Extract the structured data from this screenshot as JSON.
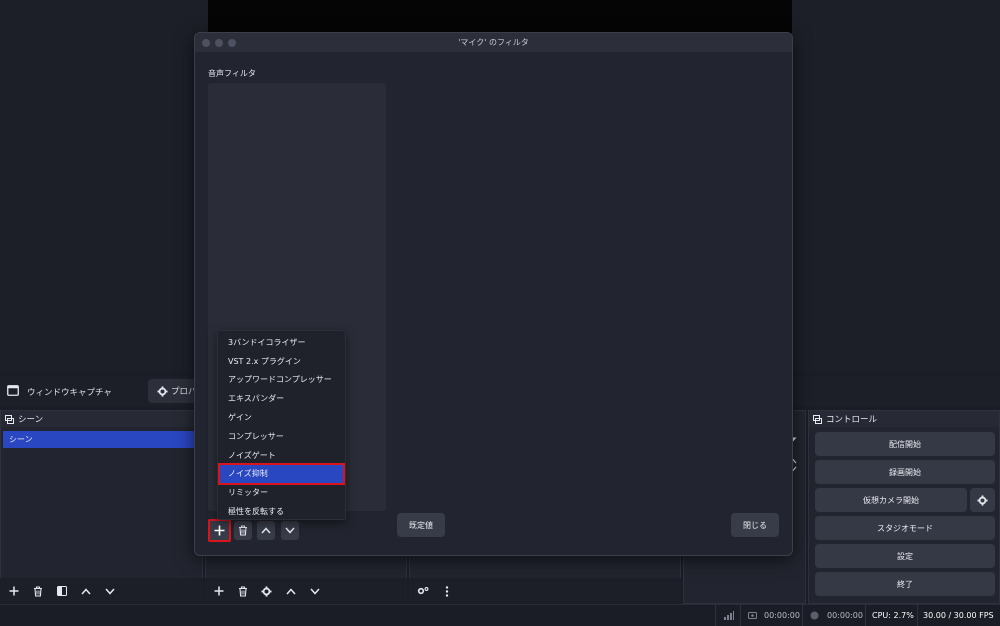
{
  "source_toolbar": {
    "source_name": "ウィンドウキャプチャ",
    "properties_label": "プロパ"
  },
  "scenes": {
    "title": "シーン",
    "items": [
      "シーン"
    ]
  },
  "controls": {
    "title": "コントロール",
    "start_streaming": "配信開始",
    "start_recording": "録画開始",
    "start_virtual_camera": "仮想カメラ開始",
    "studio_mode": "スタジオモード",
    "settings": "設定",
    "exit": "終了"
  },
  "status": {
    "stream_time": "00:00:00",
    "record_time": "00:00:00",
    "cpu": "CPU: 2.7%",
    "fps": "30.00 / 30.00 FPS"
  },
  "modal": {
    "title": "'マイク' のフィルタ",
    "section_label": "音声フィルタ",
    "defaults_label": "既定値",
    "close_label": "閉じる"
  },
  "filter_menu": {
    "items": [
      "3バンドイコライザー",
      "VST 2.x プラグイン",
      "アップワードコンプレッサー",
      "エキスパンダー",
      "ゲイン",
      "コンプレッサー",
      "ノイズゲート",
      "ノイズ抑制",
      "リミッター",
      "極性を反転する"
    ],
    "selected_index": 7
  },
  "colors": {
    "accent": "#2a47c2",
    "highlight_border": "#d9141c",
    "background": "#1b1d26",
    "panel": "#22252f"
  }
}
